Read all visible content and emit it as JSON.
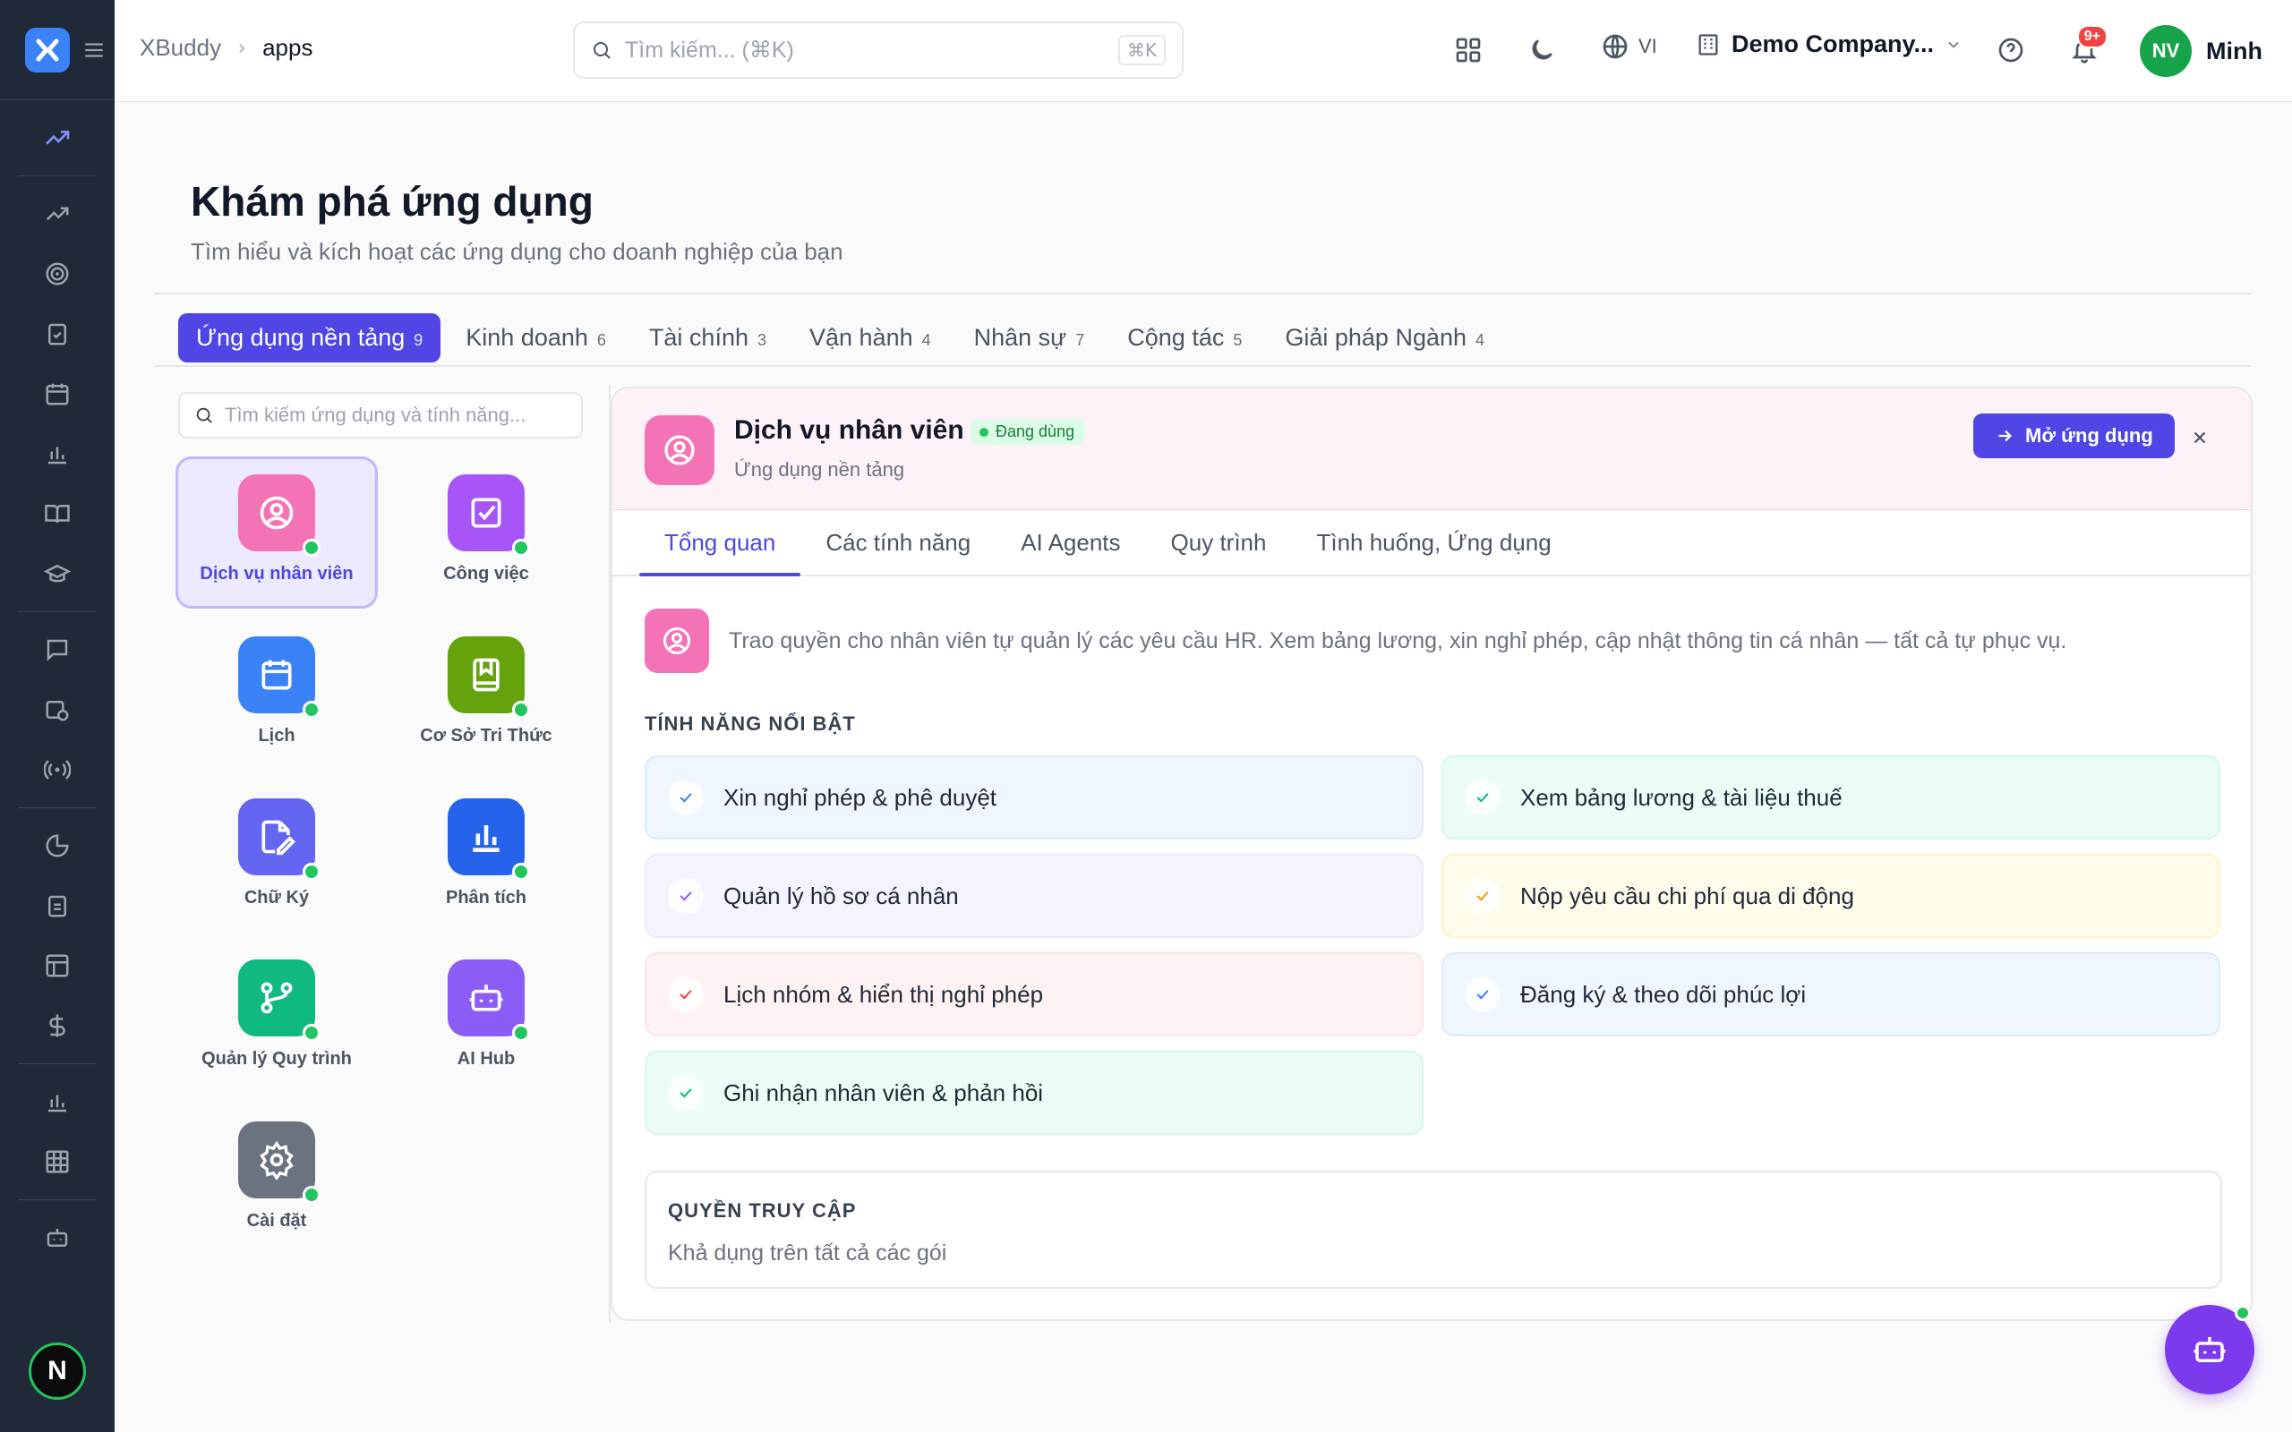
{
  "header": {
    "breadcrumb": [
      "XBuddy",
      "apps"
    ],
    "search_placeholder": "Tìm kiếm... (⌘K)",
    "search_shortcut": "⌘K",
    "language": "VI",
    "company": "Demo Company...",
    "notification_count": "9+",
    "user_initials": "NV",
    "user_name": "Minh"
  },
  "sidebar": {
    "avatar_letter": "N"
  },
  "page": {
    "title": "Khám phá ứng dụng",
    "subtitle": "Tìm hiểu và kích hoạt các ứng dụng cho doanh nghiệp của bạn"
  },
  "categories": [
    {
      "label": "Ứng dụng nền tảng",
      "count": "9",
      "active": true
    },
    {
      "label": "Kinh doanh",
      "count": "6"
    },
    {
      "label": "Tài chính",
      "count": "3"
    },
    {
      "label": "Vận hành",
      "count": "4"
    },
    {
      "label": "Nhân sự",
      "count": "7"
    },
    {
      "label": "Cộng tác",
      "count": "5"
    },
    {
      "label": "Giải pháp Ngành",
      "count": "4"
    }
  ],
  "app_search_placeholder": "Tìm kiếm ứng dụng và tính năng...",
  "apps": [
    {
      "label": "Dịch vụ nhân viên",
      "icon": "user-circle-icon",
      "color": "#f472b6"
    },
    {
      "label": "Công việc",
      "icon": "check-square-icon",
      "color": "#a855f7"
    },
    {
      "label": "Lịch",
      "icon": "calendar-icon",
      "color": "#3b82f6"
    },
    {
      "label": "Cơ Sở Tri Thức",
      "icon": "book-icon",
      "color": "#65a30d"
    },
    {
      "label": "Chữ Ký",
      "icon": "signature-icon",
      "color": "#6366f1"
    },
    {
      "label": "Phân tích",
      "icon": "bar-chart-icon",
      "color": "#2563eb"
    },
    {
      "label": "Quản lý Quy trình",
      "icon": "workflow-icon",
      "color": "#10b981"
    },
    {
      "label": "AI Hub",
      "icon": "robot-icon",
      "color": "#8b5cf6"
    },
    {
      "label": "Cài đặt",
      "icon": "gear-icon",
      "color": "#6b7280"
    }
  ],
  "detail": {
    "name": "Dịch vụ nhân viên",
    "status": "Đang dùng",
    "category": "Ứng dụng nền tảng",
    "open_button": "Mở ứng dụng",
    "tabs": [
      "Tổng quan",
      "Các tính năng",
      "AI Agents",
      "Quy trình",
      "Tình huống, Ứng dụng"
    ],
    "description": "Trao quyền cho nhân viên tự quản lý các yêu cầu HR. Xem bảng lương, xin nghỉ phép, cập nhật thông tin cá nhân — tất cả tự phục vụ.",
    "features_title": "TÍNH NĂNG NỔI BẬT",
    "features": [
      {
        "text": "Xin nghỉ phép & phê duyệt",
        "bg": "#eff6ff",
        "border": "#dbeafe",
        "check": "#3b82f6"
      },
      {
        "text": "Xem bảng lương & tài liệu thuế",
        "bg": "#ecfdf5",
        "border": "#d1fae5",
        "check": "#10b981"
      },
      {
        "text": "Quản lý hồ sơ cá nhân",
        "bg": "#f5f3ff",
        "border": "#ede9fe",
        "check": "#8b5cf6"
      },
      {
        "text": "Nộp yêu cầu chi phí qua di động",
        "bg": "#fffbeb",
        "border": "#fef3c7",
        "check": "#f59e0b"
      },
      {
        "text": "Lịch nhóm & hiển thị nghỉ phép",
        "bg": "#fef2f2",
        "border": "#fee2e2",
        "check": "#ef4444"
      },
      {
        "text": "Đăng ký & theo dõi phúc lợi",
        "bg": "#eff6ff",
        "border": "#dbeafe",
        "check": "#3b82f6"
      },
      {
        "text": "Ghi nhận nhân viên & phản hồi",
        "bg": "#ecfdf5",
        "border": "#d1fae5",
        "check": "#10b981"
      }
    ],
    "access_title": "QUYỀN TRUY CẬP",
    "access_text": "Khả dụng trên tất cả các gói"
  }
}
